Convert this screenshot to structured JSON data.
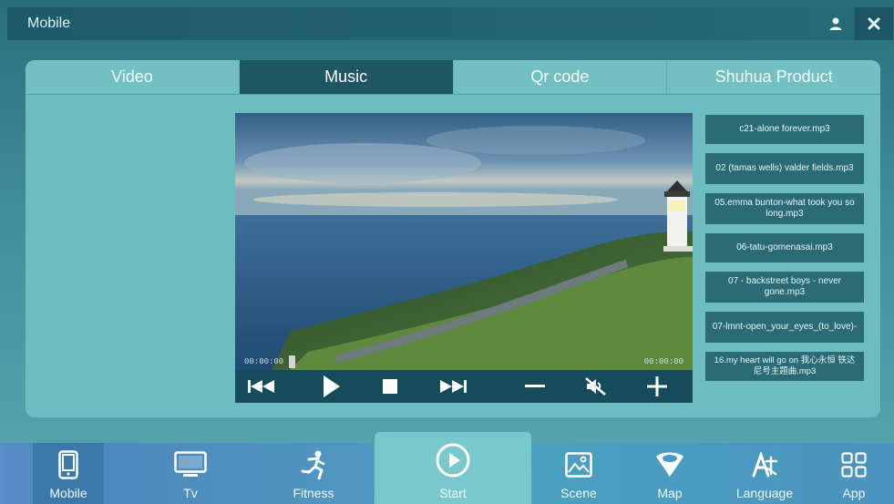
{
  "window": {
    "title": "Mobile"
  },
  "tabs": [
    {
      "label": "Video"
    },
    {
      "label": "Music"
    },
    {
      "label": "Qr code"
    },
    {
      "label": "Shuhua Product"
    }
  ],
  "active_tab": "Music",
  "player": {
    "time_current": "00:00:00",
    "time_total": "00:00:00",
    "progress": 0
  },
  "playlist": [
    "c21-alone forever.mp3",
    "02 (tamas wells) valder fields.mp3",
    "05.emma bunton-what took you so long.mp3",
    "06-tatu-gomenasai.mp3",
    "07 - backstreet boys - never gone.mp3",
    "07-lmnt-open_your_eyes_(to_love)-",
    "16.my heart will go on 我心永恒 铁达尼号主题曲.mp3"
  ],
  "nav": [
    {
      "label": "Mobile",
      "icon": "tablet-icon"
    },
    {
      "label": "Tv",
      "icon": "monitor-icon"
    },
    {
      "label": "Fitness",
      "icon": "runner-icon"
    },
    {
      "label": "Start",
      "icon": "play-circle-icon"
    },
    {
      "label": "Scene",
      "icon": "image-icon"
    },
    {
      "label": "Map",
      "icon": "map-pin-icon"
    },
    {
      "label": "Language",
      "icon": "language-icon"
    },
    {
      "label": "App",
      "icon": "grid-icon"
    }
  ],
  "colors": {
    "active_tab": "#1f5663",
    "panel": "#6dbcbf",
    "controls_bar": "#154b5b",
    "playlist_item": "#2b6b76"
  }
}
